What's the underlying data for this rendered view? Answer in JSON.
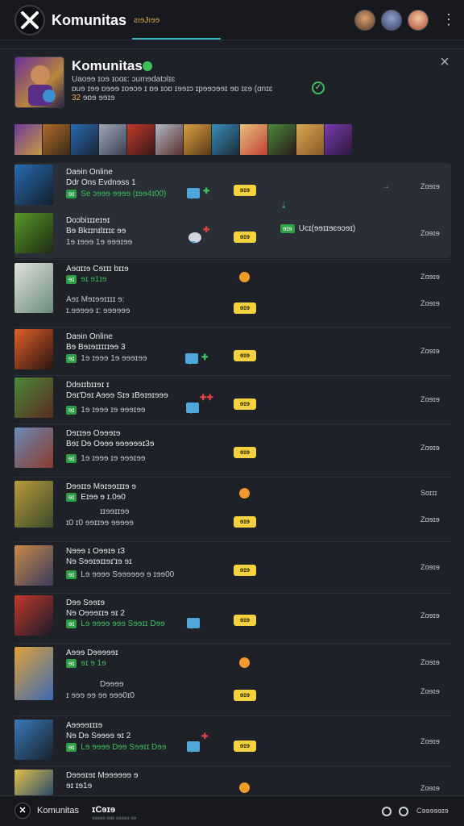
{
  "header": {
    "app_title": "Komunitas",
    "tab_label": "ƨıɘɈıɘɘ"
  },
  "community": {
    "name": "Komunitas",
    "subtitle": "Uaoɘɘ ɪoɘ ɪoɑɛ: ɔumɘdatɔlɪɛ",
    "description": "ɒuɘ ɪɘɘ ɒɘɘɘ ɪoɘɔɘ ɪ ɒɘ ɪoɒ ɪɘɘɪɔ ɪpɘɘɔɘɘɪ ɘɒ ɪɛɘ (ɑnɪɛ",
    "meta_num": "32",
    "meta_text": "ɘɒɘ ɘɘɪɘ"
  },
  "rows": [
    {
      "title": "Daɘin Online",
      "sub": "Ddr Ons Evdnɘss 1",
      "meta": "Se ɔɘɘɘ ɘɘɘɘ (ɪɘɘ4ɪ00)",
      "badge": "ɘɪ",
      "ylabel": "ɘɪɘ",
      "right": "Zɑɘɪɘ"
    },
    {
      "title": "Doɔbiɪɪɪeɪɘɪ",
      "sub": "Bɘ Bkɪɪnɪlɪɪɪɛ ɘɘ",
      "meta": "1ɘ ɪɘɘɘ 1ɘ ɘɘɘɪɘɘ",
      "badge": "ɘɪ",
      "ylabel": "ɘɪɘ",
      "right": "Zɑɘɪɘ",
      "note_badge": "ɘɪɘ",
      "note_text": "Ucɪ(ɘɘɪɪɘɛɘɔɘɪ)"
    },
    {
      "title": "Aɘɑɪɪɘ Cɘɪɪɪ bɪɪɘ",
      "sub": "Aɘɪ Mɘɪɘɘɪɪɪɪ ɘ:",
      "meta": "ɪ.ɘɘɘɘɘ ɪ: ɘɘɘɘɘɘ",
      "badge": "ɘɪ",
      "badge_text": "ɘɪ ɘ1ɪɘ",
      "ylabel": "ɘɪɘ",
      "right": "Zɑɘɪɘ",
      "right2": "Zɑɘɪɘ"
    },
    {
      "title": "Daɘin Online",
      "sub": "Bɘ Bɘɪɘɪɪɪɪɪɘɘ 3",
      "meta": "1ɘ ɪɘɘɘ 1ɘ ɘɘɘɪɘɘ",
      "badge": "ɘɪ",
      "ylabel": "ɘɪɘ",
      "right": "Zɑɘɪɘ"
    },
    {
      "title": "Ddɘɪɪbɪɪɘɪ ɪ",
      "sub": "Dɘɪ'Dɘɪ Aɘɘɘ Sɪɘ ɪBɘɪɘɪɘɘɘ",
      "meta": "1ɘ ɪɘɘɘ ɪɘ ɘɘɘɪɘɘ",
      "badge": "ɘɪ",
      "ylabel": "ɘɪɘ",
      "right": "Zɑɘɪɘ"
    },
    {
      "title": "Dɘɪɪɘɘ Oɘɘɘɪɘ",
      "sub": "Bɘɪ Dɘ Oɘɘɘ ɘɘɘɘɘɘɪ3ɘ",
      "meta": "1ɘ ɪɘɘɘ ɪɘ ɘɘɘɪɘɘ",
      "badge": "ɘɪ",
      "ylabel": "ɘɪɘ",
      "right": "Zɑɘɪɘ"
    },
    {
      "title": "Dɘɘɪɪɘ Mɘɪɘɘɪɪɪɘ ɘ",
      "sub": "Eɪɘɘ ɘ ɪ.0ɘ0",
      "meta": "ɪ0 ɪ0 ɘɘɪɪɘɘ ɘɘɘɘɘ",
      "badge": "ɘɪ",
      "ylabel": "ɘɪɘ",
      "right": "Sɑɪɪɪ",
      "right2": "Zɑɘɪɘ",
      "subnote": "ɪɪɘɘɪɪɘɘ"
    },
    {
      "title": "Nɘɘɘ ɪ Oɘɘɪɘ ɪ3",
      "sub": "Nɘ Sɘɘɪɘɪɪɘɪ'ɪɘ ɘɪ",
      "meta": "Lɘ ɘɘɘɘ Sɘɘɘɘɘɘ ɘ ɪɘɘ00",
      "badge": "ɘɪ",
      "ylabel": "ɘɪɘ",
      "right": "Zɑɘɪɘ"
    },
    {
      "title": "Dɘɘ Sɘɘɪɘ",
      "sub": "Nɘ Oɘɘɘɪɪɘ ɘɪ 2",
      "meta": "Lɘ ɘɘɘɘ ɘɘɘ Sɘɘɪɪ Dɘɘ",
      "badge": "ɘɪ",
      "ylabel": "ɘɪɘ",
      "right": "Zɑɘɪɘ"
    },
    {
      "title": "Aɘɘɘ Dɘɘɘɘɘɪ",
      "sub": "ɘɪ ɘ 1ɘ",
      "meta": "ɪ ɘɘɘ ɘɘ ɘɘ ɘɘɘ0ɪ0",
      "badge": "ɘɪ",
      "ylabel": "ɘɪɘ",
      "right": "Zɑɘɪɘ",
      "right2": "Zɑɘɪɘ",
      "subnote": "Dɘɘɘɘ"
    },
    {
      "title": "Aɘɘɘɘɪɪɪɘ",
      "sub": "Nɘ Dɘ Sɘɘɘɘ ɘɪ 2",
      "meta": "Lɘ ɘɘɘɘ Dɘɘ Sɘɘɪɪ Dɘɘ",
      "badge": "ɘɪ",
      "ylabel": "ɘɪɘ",
      "right": "Zɑɘɪɘ"
    },
    {
      "title": "Dɘɘɘɪɘɪ Mɘɘɘɘɘɘ ɘ",
      "sub": "ɘɪ ɪɘ1ɘ",
      "meta": "",
      "badge": "ɘɪ",
      "ylabel": "ɘɪɘ",
      "right": "Zɑɘɪɘ"
    }
  ],
  "bottom": {
    "name": "Komunitas",
    "name2": "ɪCɘɪɘ",
    "fine": "ɘɘɘɘɘ ɘɘɘ ɘɘɘɘɘ ɘɘ",
    "label": "Cɘɘɘɘɘɪɘ"
  }
}
